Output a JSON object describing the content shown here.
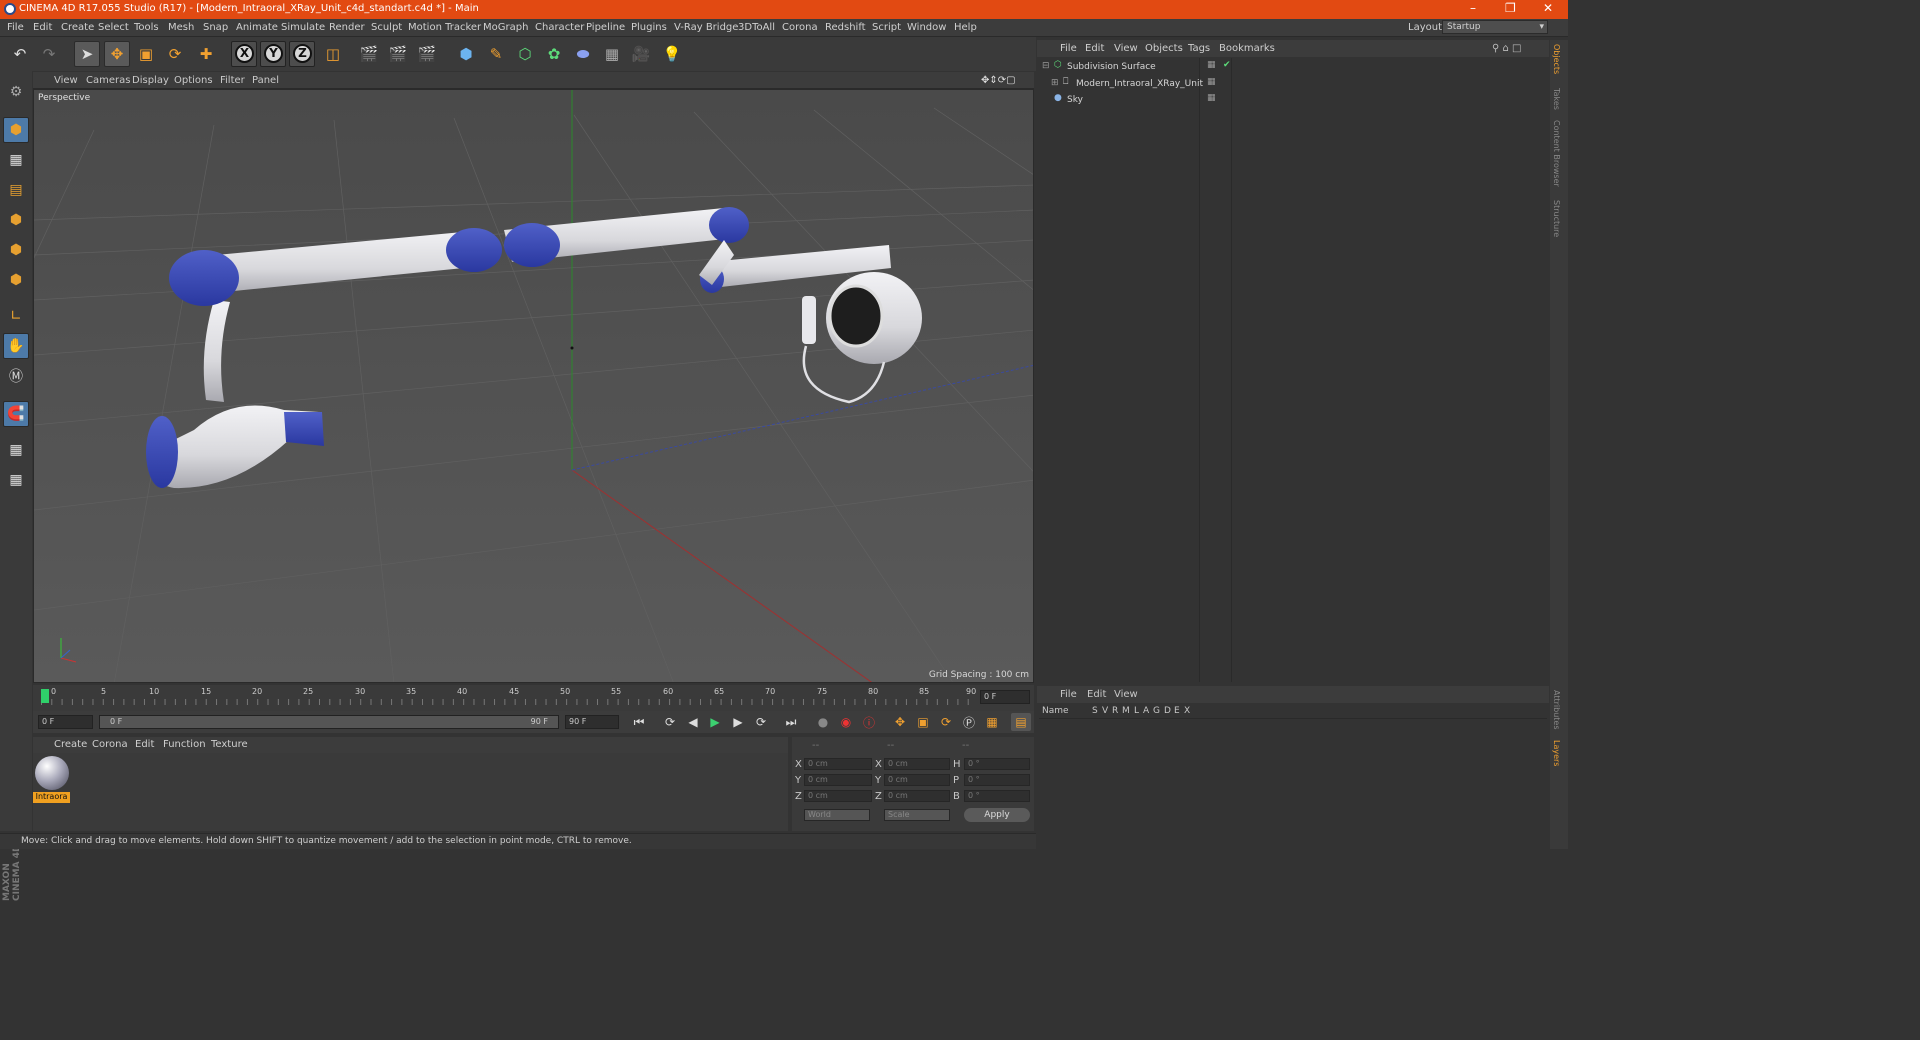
{
  "window": {
    "title": "CINEMA 4D R17.055 Studio (R17) - [Modern_Intraoral_XRay_Unit_c4d_standart.c4d *] - Main"
  },
  "menu": [
    "File",
    "Edit",
    "Create",
    "Select",
    "Tools",
    "Mesh",
    "Snap",
    "Animate",
    "Simulate",
    "Render",
    "Sculpt",
    "Motion Tracker",
    "MoGraph",
    "Character",
    "Pipeline",
    "Plugins",
    "V-Ray Bridge",
    "3DToAll",
    "Corona",
    "Redshift",
    "Script",
    "Window",
    "Help"
  ],
  "layout": {
    "label": "Layout:",
    "value": "Startup"
  },
  "toolbar": {
    "axis_x": "X",
    "axis_y": "Y",
    "axis_z": "Z"
  },
  "viewport": {
    "menu": [
      "View",
      "Cameras",
      "Display",
      "Options",
      "Filter",
      "Panel"
    ],
    "label": "Perspective",
    "grid_spacing": "Grid Spacing : 100 cm"
  },
  "timeline": {
    "ticks": [
      "0",
      "5",
      "10",
      "15",
      "20",
      "25",
      "30",
      "35",
      "40",
      "45",
      "50",
      "55",
      "60",
      "65",
      "70",
      "75",
      "80",
      "85",
      "90"
    ],
    "frame_end_field": "0 F",
    "current_frame": "0 F",
    "range_start": "0 F",
    "range_end": "90 F",
    "range_end2": "90 F"
  },
  "materials": {
    "menu": [
      "Create",
      "Corona",
      "Edit",
      "Function",
      "Texture"
    ],
    "items": [
      {
        "name": "Intraora"
      }
    ]
  },
  "coords": {
    "head": [
      "--",
      "--",
      "--"
    ],
    "rows": [
      {
        "a": "X",
        "v1": "0 cm",
        "b": "X",
        "v2": "0 cm",
        "c": "H",
        "v3": "0 °"
      },
      {
        "a": "Y",
        "v1": "0 cm",
        "b": "Y",
        "v2": "0 cm",
        "c": "P",
        "v3": "0 °"
      },
      {
        "a": "Z",
        "v1": "0 cm",
        "b": "Z",
        "v2": "0 cm",
        "c": "B",
        "v3": "0 °"
      }
    ],
    "mode1": "World",
    "mode2": "Scale",
    "apply": "Apply"
  },
  "status": "Move: Click and drag to move elements. Hold down SHIFT to quantize movement / add to the selection in point mode, CTRL to remove.",
  "objects": {
    "menu": [
      "File",
      "Edit",
      "View",
      "Objects",
      "Tags",
      "Bookmarks"
    ],
    "items": [
      {
        "name": "Subdivision Surface"
      },
      {
        "name": "Modern_Intraoral_XRay_Unit"
      },
      {
        "name": "Sky"
      }
    ]
  },
  "attributes": {
    "menu": [
      "File",
      "Edit",
      "View"
    ],
    "columns": [
      "Name",
      "S",
      "V",
      "R",
      "M",
      "L",
      "A",
      "G",
      "D",
      "E",
      "X"
    ]
  },
  "right_tabs": [
    "Objects",
    "Takes",
    "Content Browser",
    "Structure",
    "Attributes",
    "Layers"
  ],
  "branding": "MAXON CINEMA 4D"
}
